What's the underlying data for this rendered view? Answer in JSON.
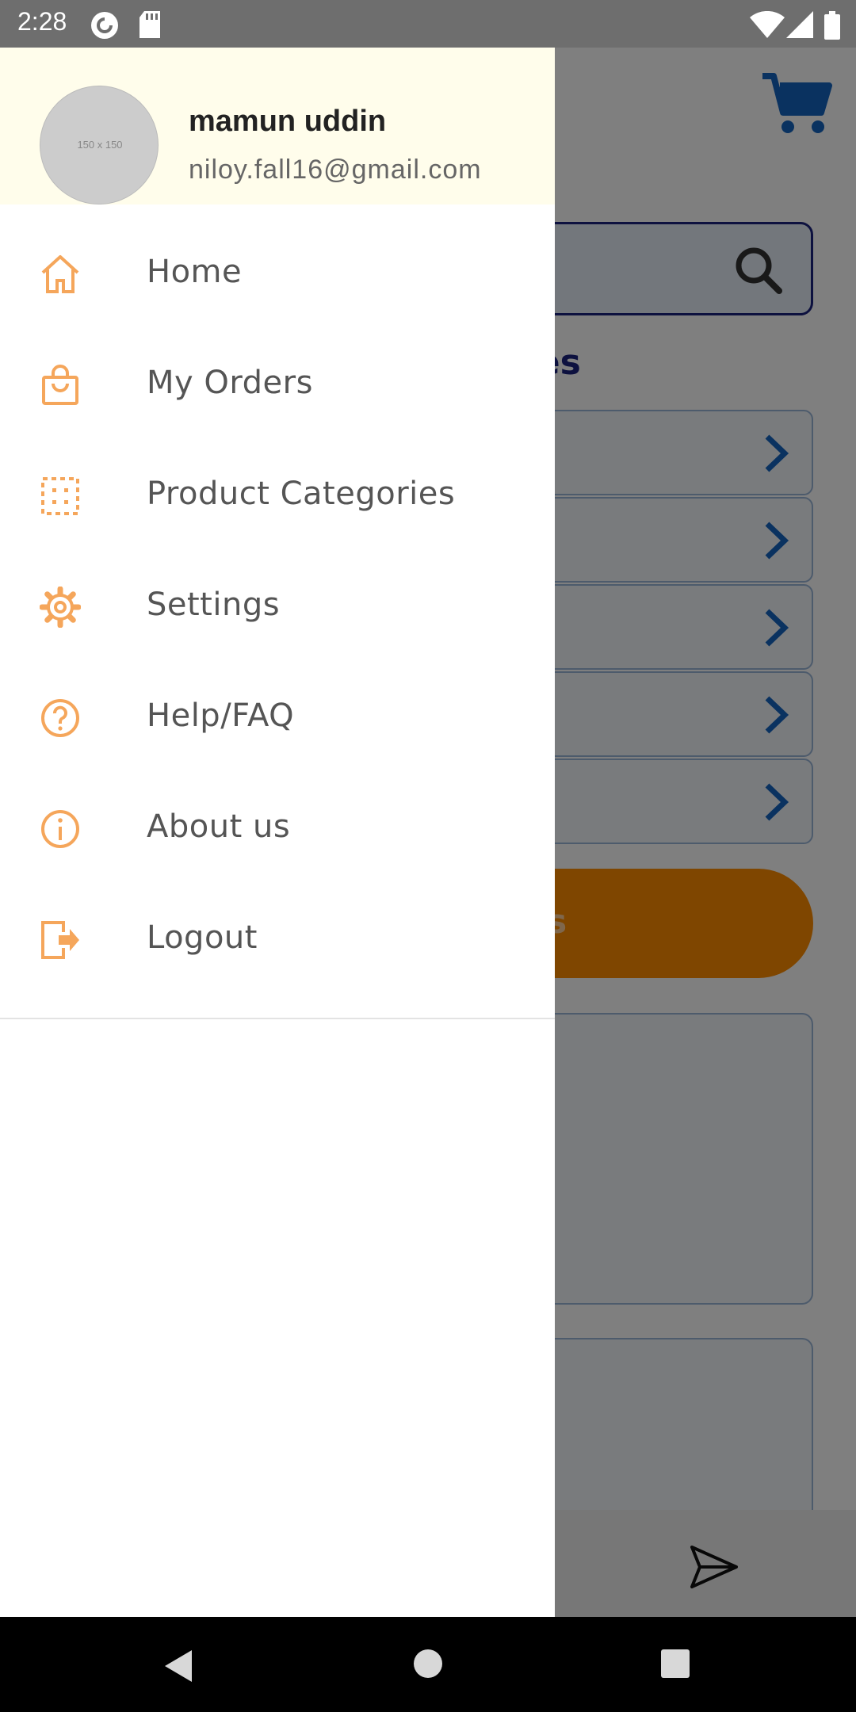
{
  "status_bar": {
    "time": "2:28",
    "icons": [
      "pocket-casts-icon",
      "sd-card-icon",
      "wifi-icon",
      "signal-icon",
      "battery-icon"
    ]
  },
  "background": {
    "section_title_visible": "ries",
    "button_text_visible": "ts",
    "colors": {
      "accent": "#1a237e",
      "button": "#ff8c00",
      "chevron": "#1565c0"
    }
  },
  "drawer": {
    "avatar_placeholder": "150 x 150",
    "user_name": "mamun uddin",
    "user_email": "niloy.fall16@gmail.com",
    "icon_color": "#f5a65b",
    "items": [
      {
        "label": "Home",
        "icon": "home-icon"
      },
      {
        "label": "My Orders",
        "icon": "shopping-bag-icon"
      },
      {
        "label": "Product Categories",
        "icon": "categories-grid-icon"
      },
      {
        "label": "Settings",
        "icon": "gear-icon"
      },
      {
        "label": "Help/FAQ",
        "icon": "help-icon"
      },
      {
        "label": "About us",
        "icon": "info-icon"
      },
      {
        "label": "Logout",
        "icon": "logout-icon"
      }
    ]
  },
  "nav_bar": {
    "buttons": [
      "back-icon",
      "home-circle-icon",
      "recents-icon"
    ]
  }
}
